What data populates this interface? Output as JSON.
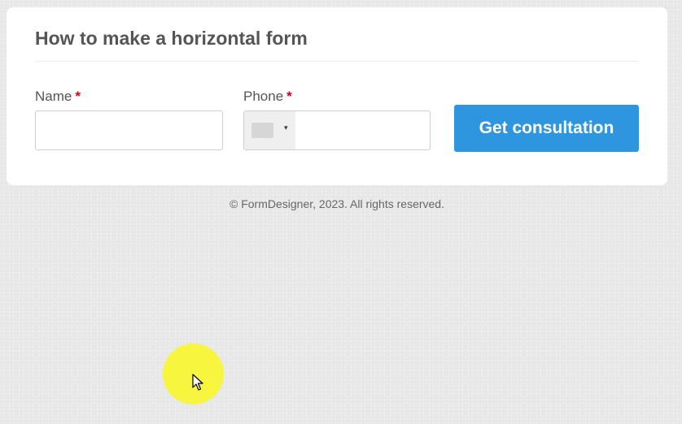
{
  "form": {
    "title": "How to make a horizontal form",
    "fields": {
      "name": {
        "label": "Name",
        "required_mark": "*",
        "value": "",
        "placeholder": ""
      },
      "phone": {
        "label": "Phone",
        "required_mark": "*",
        "value": "",
        "placeholder": "",
        "country_caret": "▾"
      }
    },
    "submit_label": "Get consultation"
  },
  "footer": {
    "text": "© FormDesigner, 2023. All rights reserved."
  },
  "colors": {
    "accent": "#2d96de",
    "required": "#d0021b",
    "cursor_highlight": "#f8f53e"
  }
}
